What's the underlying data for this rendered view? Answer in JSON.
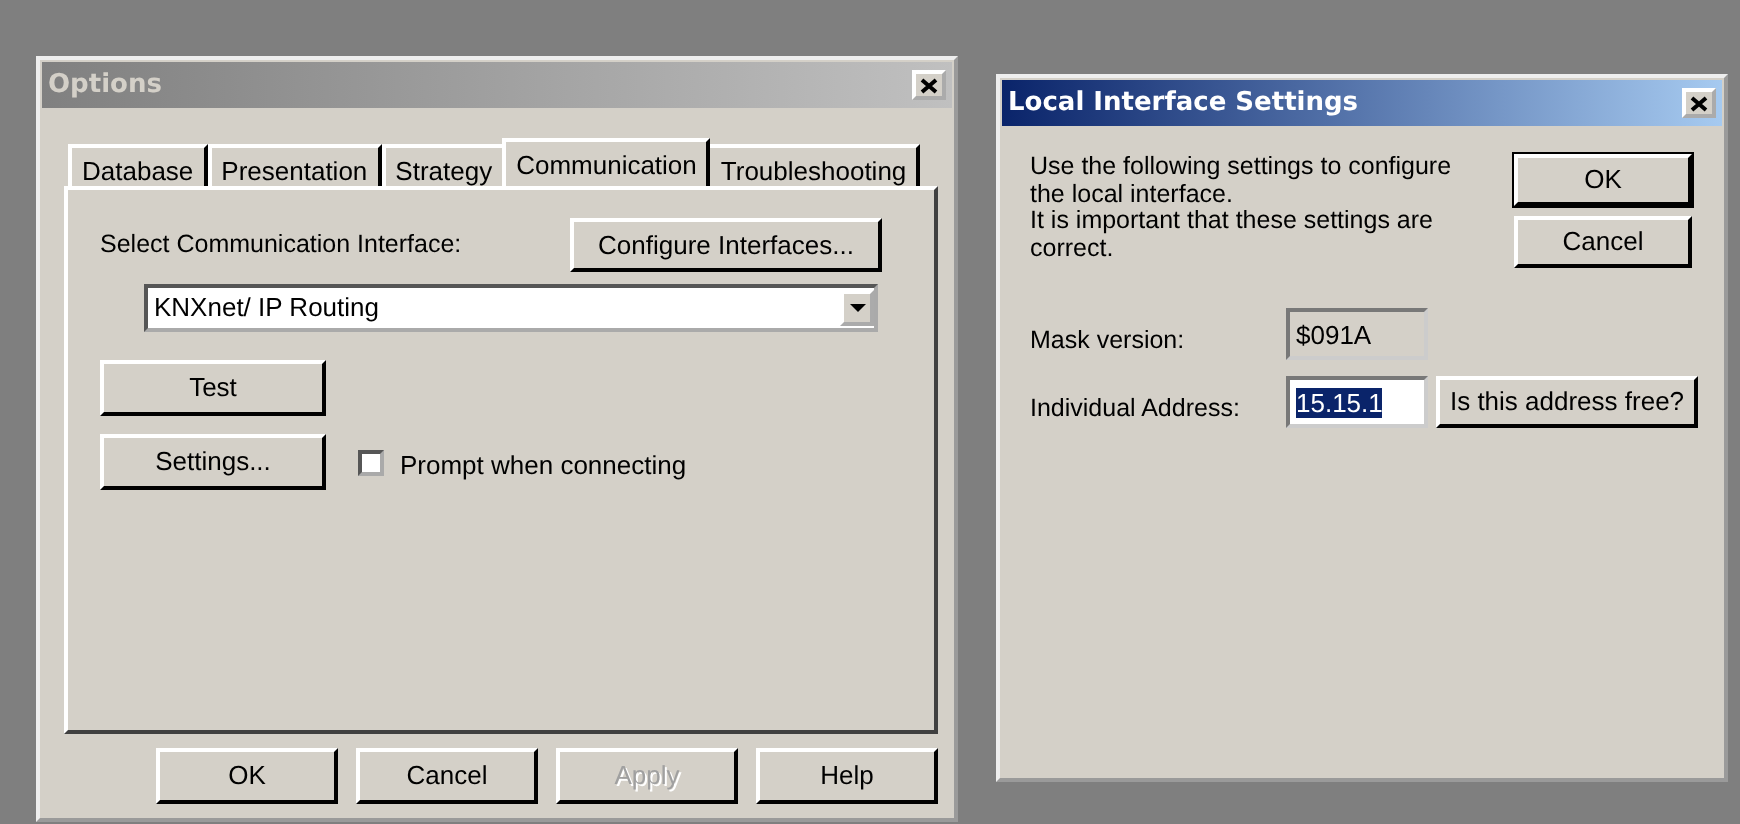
{
  "options_window": {
    "title": "Options",
    "active": false,
    "tabs": [
      {
        "label": "Database",
        "selected": false
      },
      {
        "label": "Presentation",
        "selected": false
      },
      {
        "label": "Strategy",
        "selected": false
      },
      {
        "label": "Communication",
        "selected": true
      },
      {
        "label": "Troubleshooting",
        "selected": false
      }
    ],
    "interface_label": "Select Communication Interface:",
    "configure_button": {
      "label": "Configure Interfaces...",
      "disabled": false
    },
    "interface_select": {
      "value": "KNXnet/ IP Routing"
    },
    "test_button": {
      "label": "Test",
      "disabled": false
    },
    "settings_button": {
      "label": "Settings...",
      "disabled": false
    },
    "prompt_checkbox": {
      "label": "Prompt when connecting",
      "checked": false
    },
    "buttons": [
      {
        "label": "OK",
        "disabled": false
      },
      {
        "label": "Cancel",
        "disabled": false
      },
      {
        "label": "Apply",
        "disabled": true
      },
      {
        "label": "Help",
        "disabled": false
      }
    ]
  },
  "settings_window": {
    "title": "Local Interface Settings",
    "active": true,
    "description": [
      "Use the following settings to configure the local interface.",
      "It is important that these settings are correct."
    ],
    "buttons": [
      {
        "label": "OK",
        "default": true
      },
      {
        "label": "Cancel",
        "default": false
      }
    ],
    "mask_version": {
      "label": "Mask version:",
      "value": "$091A",
      "readonly": true
    },
    "individual_address": {
      "label": "Individual Address:",
      "value": "15.15.1",
      "text_selected": true,
      "readonly": false
    },
    "check_button": {
      "label": "Is this address free?"
    }
  }
}
